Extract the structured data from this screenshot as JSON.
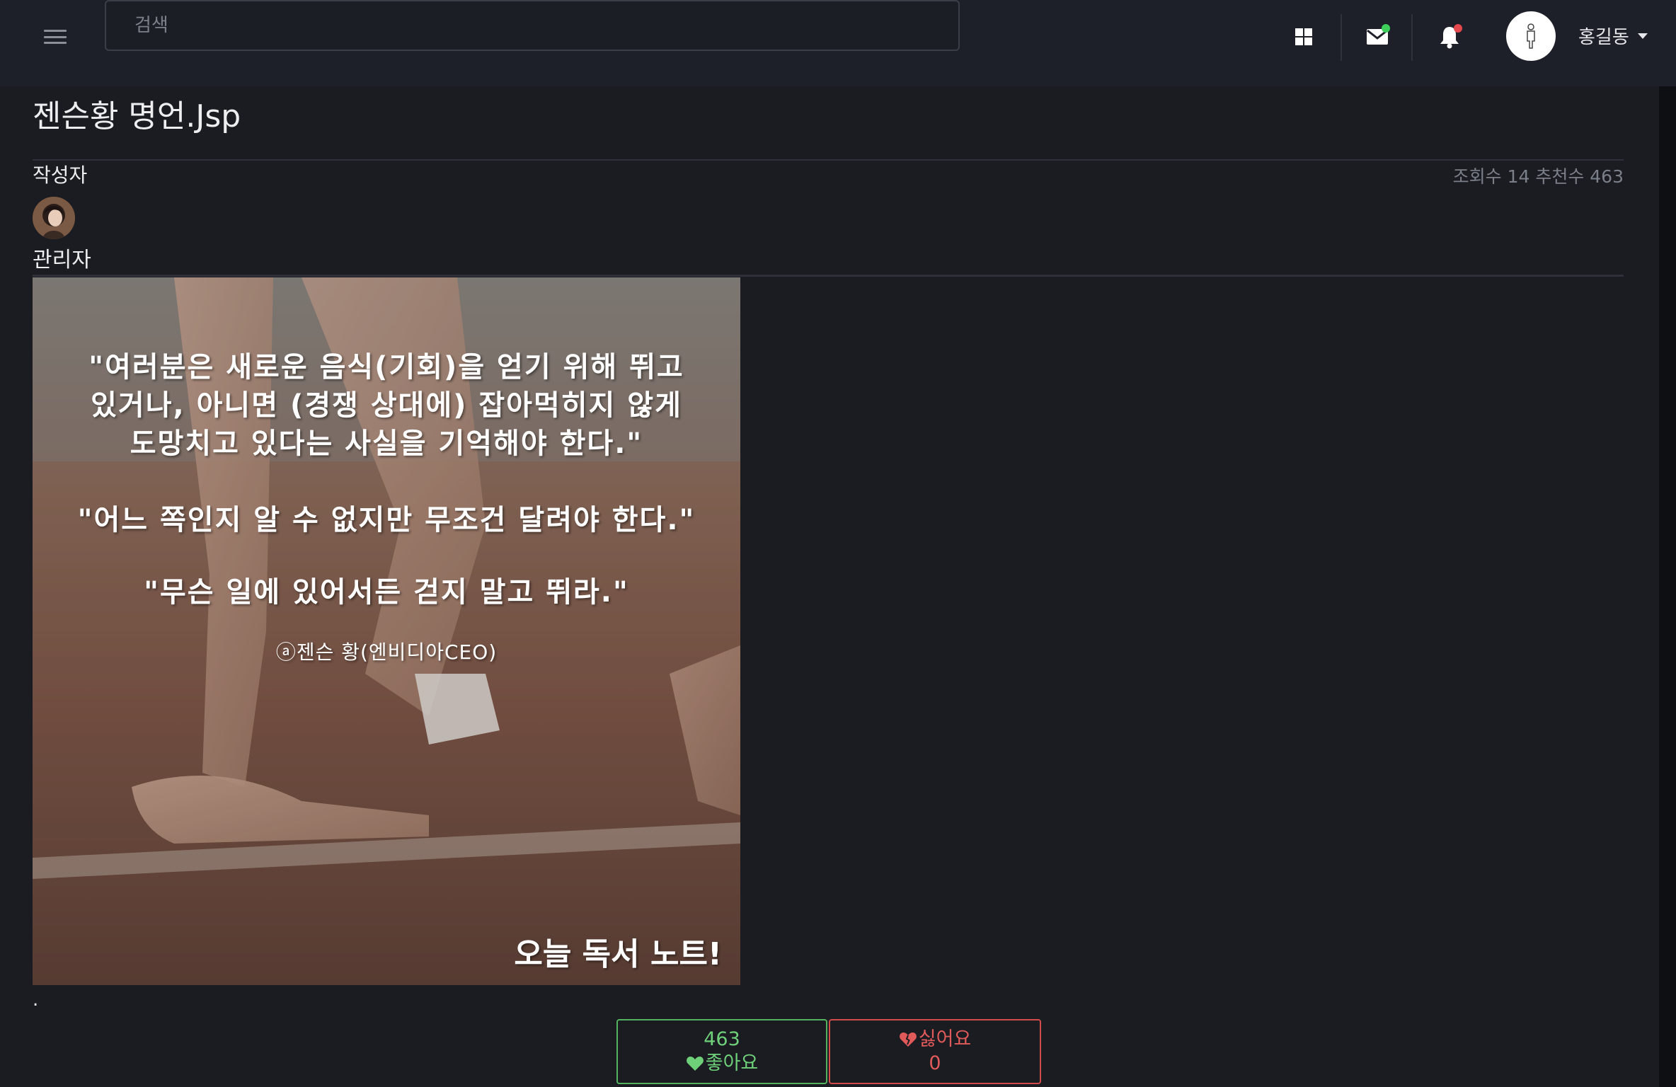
{
  "header": {
    "search_placeholder": "검색",
    "user_name": "홍길동",
    "icons": [
      "menu-icon",
      "grid-icon",
      "mail-icon",
      "bell-icon",
      "user-icon",
      "chevron-down-icon"
    ],
    "colors": {
      "mail_badge": "#3ecf5a",
      "bell_badge": "#e5484d"
    }
  },
  "post": {
    "title": "젠슨황 명언.Jsp",
    "author_label": "작성자",
    "stats": "조회수 14 추천수 463",
    "author_name": "관리자",
    "image": {
      "quote_1": "\"여러분은 새로운 음식(기회)을 얻기 위해 뛰고\n있거나, 아니면 (경쟁 상대에) 잡아먹히지 않게\n도망치고 있다는 사실을 기억해야 한다.\"",
      "quote_2": "\"어느 쪽인지 알 수 없지만 무조건 달려야 한다.\"",
      "quote_3": "\"무슨 일에 있어서든 걷지 말고 뛰라.\"",
      "credit": "ⓐ젠슨 황(엔비디아CEO)",
      "brand": "오늘 독서 노트!"
    },
    "body_text": "."
  },
  "reactions": {
    "like_count": "463",
    "like_label": "좋아요",
    "dislike_label": "싫어요",
    "dislike_count": "0",
    "colors": {
      "like": "#52b45e",
      "dislike": "#d14b4b"
    }
  }
}
